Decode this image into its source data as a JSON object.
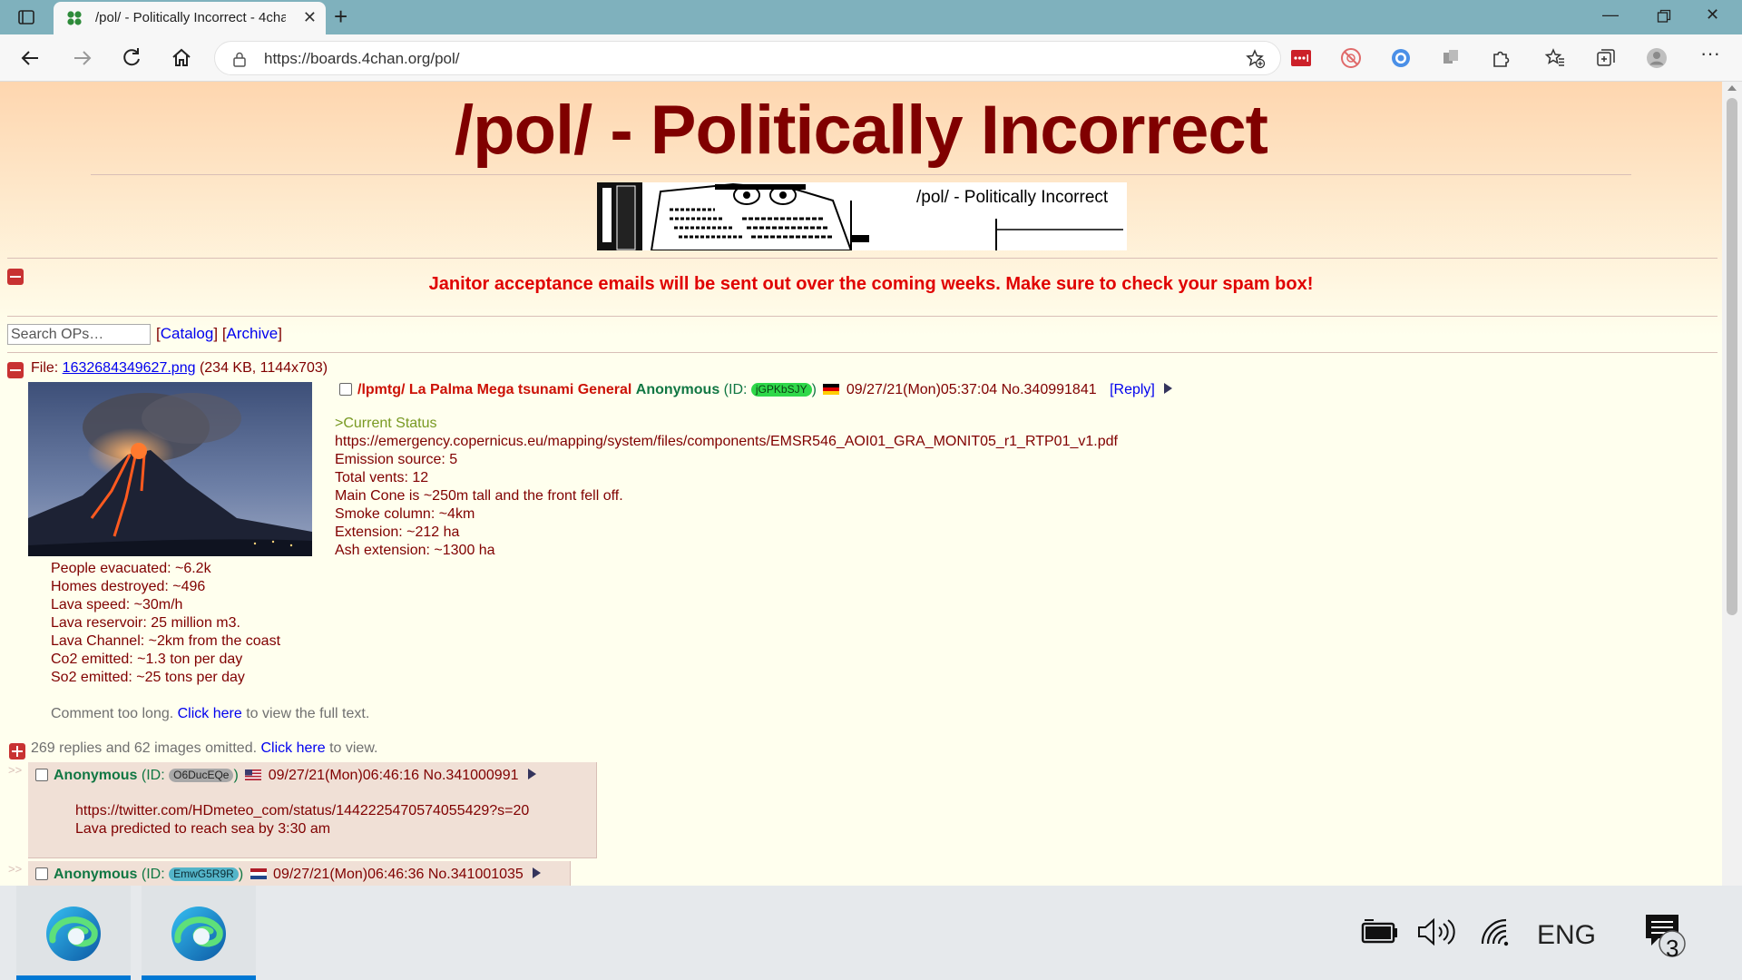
{
  "browser": {
    "tab_title": "/pol/ - Politically Incorrect - 4cha",
    "url": "https://boards.4chan.org/pol/"
  },
  "page": {
    "board_title": "/pol/ - Politically Incorrect",
    "banner_text": "/pol/ - Politically Incorrect",
    "announcement": "Janitor acceptance emails will be sent out over the coming weeks. Make sure to check your spam box!",
    "search_placeholder": "Search OPs…",
    "catalog_label": "Catalog",
    "archive_label": "Archive",
    "bracket_open": "[",
    "bracket_close": "]",
    "op": {
      "file_prefix": "File: ",
      "file_name": "1632684349627.png",
      "file_meta": " (234 KB, 1144x703)",
      "subject": "/lpmtg/ La Palma Mega tsunami General",
      "name": "Anonymous",
      "id_prefix": " (ID: ",
      "id": "jGPKbSJY",
      "id_suffix": ")",
      "datetime": "09/27/21(Mon)05:37:04",
      "post_no": "No.340991841",
      "reply_label": "Reply",
      "lines": [
        ">Current Status",
        "https://emergency.copernicus.eu/mapping/system/files/components/EMSR546_AOI01_GRA_MONIT05_r1_RTP01_v1.pdf",
        "Emission source: 5",
        "Total vents: 12",
        "Main Cone is ~250m tall and the front fell off.",
        "Smoke column: ~4km",
        "Extension: ~212 ha",
        "Ash extension: ~1300 ha"
      ],
      "lines_below": [
        "People evacuated: ~6.2k",
        "Homes destroyed: ~496",
        "Lava speed: ~30m/h",
        "Lava reservoir: 25 million m3.",
        "Lava Channel: ~2km from the coast",
        "Co2 emitted: ~1.3 ton per day",
        "So2 emitted: ~25 tons per day"
      ],
      "too_long": "Comment too long. ",
      "click_here": "Click here",
      "too_long_suffix": " to view the full text."
    },
    "omitted": {
      "text": "269 replies and 62 images omitted. ",
      "click_here": "Click here",
      "suffix": " to view."
    },
    "replies": [
      {
        "name": "Anonymous",
        "id_prefix": " (ID: ",
        "id": "O6DucEQe",
        "id_suffix": ")",
        "datetime": "09/27/21(Mon)06:46:16",
        "post_no": "No.341000991",
        "lines": [
          "https://twitter.com/HDmeteo_com/status/1442225470574055429?s=20",
          "Lava predicted to reach sea by 3:30 am"
        ]
      },
      {
        "name": "Anonymous",
        "id_prefix": " (ID: ",
        "id": "EmwG5R9R",
        "id_suffix": ")",
        "datetime": "09/27/21(Mon)06:46:36",
        "post_no": "No.341001035"
      }
    ],
    "side_arrows": ">>"
  },
  "taskbar": {
    "language": "ENG",
    "notification_count": "3"
  },
  "colors": {
    "title": "#800000",
    "subject": "#cc1105",
    "name": "#117743",
    "quote": "#789922",
    "link": "#0000ee",
    "reply_bg": "#f0e0d6",
    "announcement": "#e00000"
  }
}
